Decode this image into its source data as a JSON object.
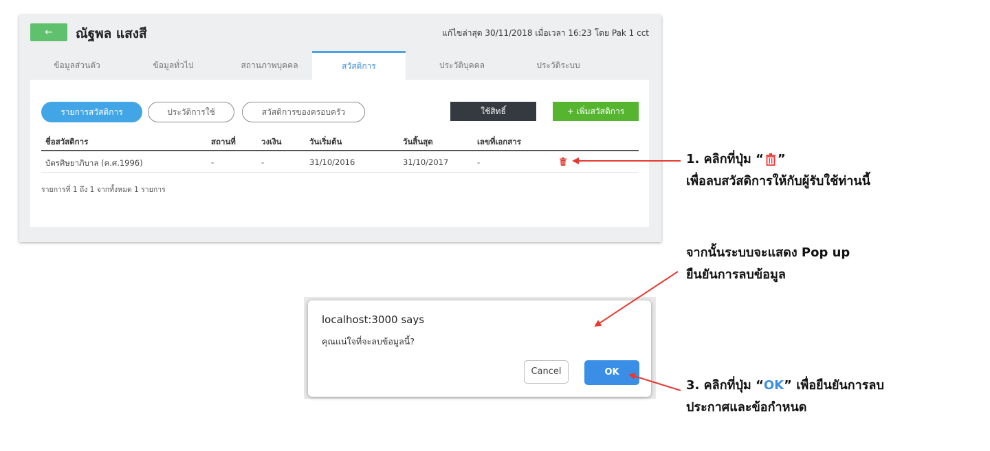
{
  "header": {
    "back_label": "←",
    "title": "ณัฐพล แสงสี",
    "edit_info": "แก้ไขล่าสุด 30/11/2018 เมื่อเวลา 16:23 โดย Pak 1 cct"
  },
  "tabs": [
    {
      "label": "ข้อมูลส่วนตัว"
    },
    {
      "label": "ข้อมูลทั่วไป"
    },
    {
      "label": "สถานภาพบุคคล"
    },
    {
      "label": "สวัสดิการ"
    },
    {
      "label": "ประวัติบุคคล"
    },
    {
      "label": "ประวัติระบบ"
    }
  ],
  "subtabs": [
    {
      "label": "รายการสวัสดิการ"
    },
    {
      "label": "ประวัติการใช้"
    },
    {
      "label": "สวัสดิการของครอบครัว"
    }
  ],
  "buttons": {
    "use_right": "ใช้สิทธิ์",
    "add_welfare": "+ เพิ่มสวัสดิการ"
  },
  "table": {
    "headers": [
      "ชื่อสวัสดิการ",
      "สถานที่",
      "วงเงิน",
      "วันเริ่มต้น",
      "วันสิ้นสุด",
      "เลขที่เอกสาร"
    ],
    "rows": [
      [
        "บัตรศิษยาภิบาล (ค.ศ.1996)",
        "-",
        "-",
        "31/10/2016",
        "31/10/2017",
        "-"
      ]
    ],
    "summary": "รายการที่ 1 ถึง 1 จากทั้งหมด 1 รายการ"
  },
  "notes": {
    "step1_prefix": "1. คลิกที่ปุ่ม “",
    "step1_suffix": "”",
    "step1_line2": "เพื่อลบสวัสดิการให้กับผู้รับใช้ท่านนี้",
    "step2_line1": "จากนั้นระบบจะแสดง Pop up",
    "step2_line2": "ยืนยันการลบข้อมูล",
    "step3_prefix": "3. คลิกที่ปุ่ม “",
    "step3_ok": "OK",
    "step3_suffix": "” เพื่อยืนยันการลบ",
    "step3_line2": "ประกาศและข้อกำหนด"
  },
  "dialog": {
    "title": "localhost:3000 says",
    "message": "คุณแน่ใจที่จะลบข้อมูลนี้?",
    "cancel": "Cancel",
    "ok": "OK"
  },
  "colors": {
    "accent": "#42a5e6",
    "green": "#55b52f",
    "delete_red": "#e53935",
    "arrow_red": "#e8392f"
  },
  "icons": {
    "trash": "trash-icon"
  }
}
